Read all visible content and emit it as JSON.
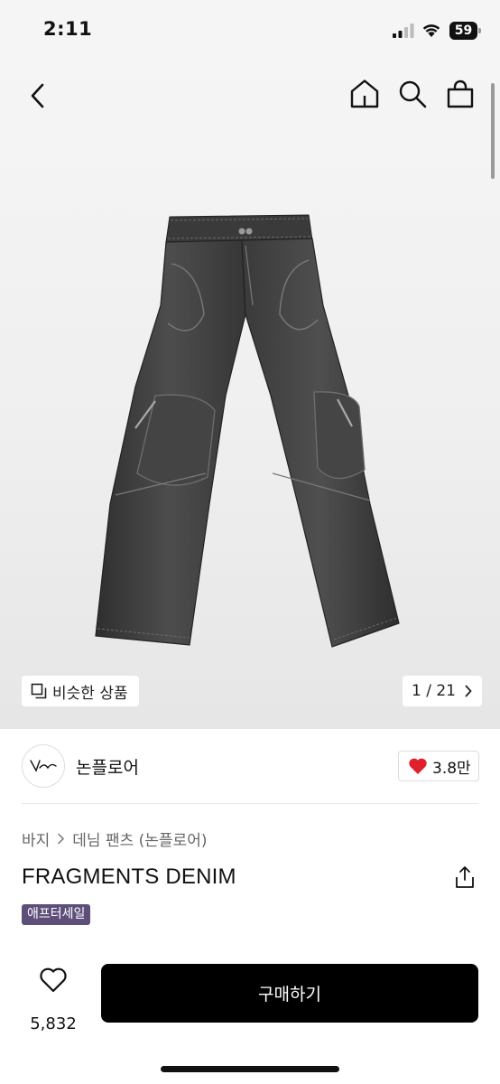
{
  "status_bar": {
    "time": "2:11",
    "battery": "59",
    "battery_level": 0.59
  },
  "header": {
    "back_icon": "chevron-left-icon",
    "home_icon": "home-icon",
    "search_icon": "search-icon",
    "bag_icon": "shopping-bag-icon"
  },
  "gallery": {
    "similar_label": "비슷한 상품",
    "similar_icon": "similar-items-icon",
    "counter": "1 / 21",
    "image_alt_icon": "jeans-icon"
  },
  "brand": {
    "name": "논플로어",
    "likes": "3.8만",
    "like_color": "#e0202c"
  },
  "product": {
    "breadcrumb": [
      "바지",
      "데님 팬츠 (논플로어)"
    ],
    "title": "FRAGMENTS DENIM",
    "badge": "애프터세일",
    "badge_color": "#5e4f7a"
  },
  "bottom": {
    "wish_count": "5,832",
    "buy_label": "구매하기"
  }
}
